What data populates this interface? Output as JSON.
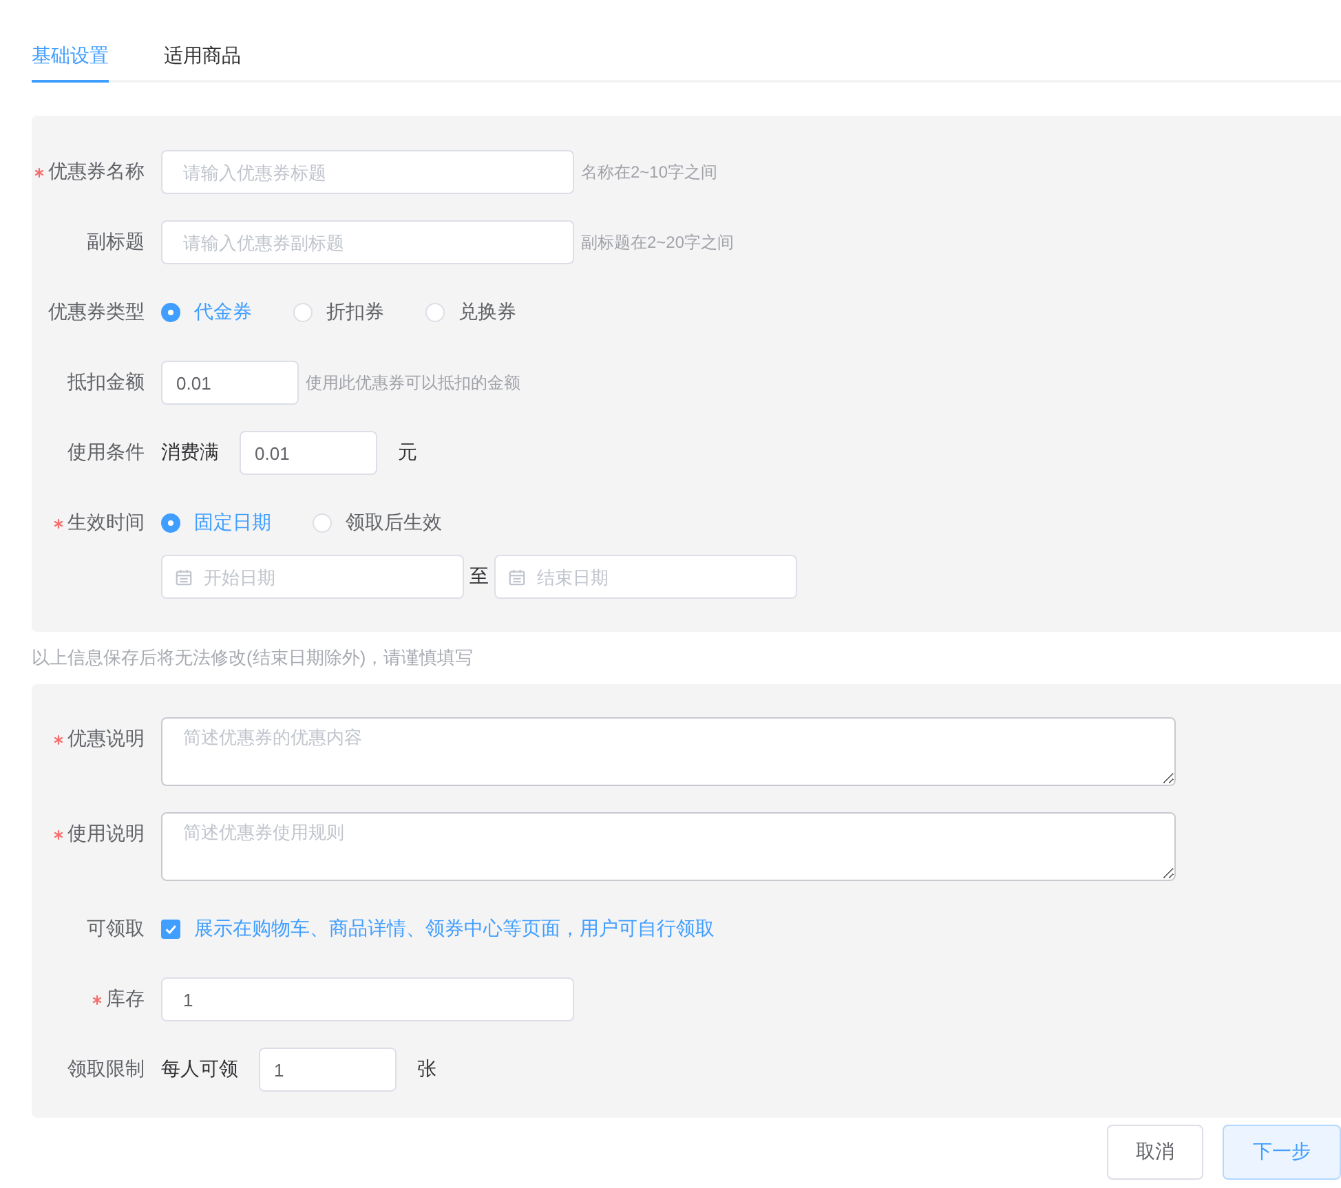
{
  "tabs": [
    {
      "label": "基础设置",
      "selected": true
    },
    {
      "label": "适用商品",
      "selected": false
    }
  ],
  "basic_section": {
    "fields": [
      {
        "kind": "text",
        "label": "优惠券名称",
        "required": true,
        "placeholder": "请输入优惠券标题",
        "hint": "名称在2~10字之间"
      },
      {
        "kind": "text",
        "label": "副标题",
        "required": false,
        "placeholder": "请输入优惠券副标题",
        "hint": "副标题在2~20字之间"
      },
      {
        "kind": "radio",
        "label": "优惠券类型",
        "required": false,
        "options": [
          {
            "label": "代金券",
            "selected": true
          },
          {
            "label": "折扣券",
            "selected": false
          },
          {
            "label": "兑换券",
            "selected": false
          }
        ]
      },
      {
        "kind": "amount",
        "label": "抵扣金额",
        "required": false,
        "value": "0.01",
        "hint": "使用此优惠券可以抵扣的金额"
      },
      {
        "kind": "condition",
        "label": "使用条件",
        "required": false,
        "prefix": "消费满",
        "value": "0.01",
        "suffix": "元"
      },
      {
        "kind": "radio",
        "label": "生效时间",
        "required": true,
        "options": [
          {
            "label": "固定日期",
            "selected": true
          },
          {
            "label": "领取后生效",
            "selected": false
          }
        ]
      },
      {
        "kind": "date_range",
        "start_placeholder": "开始日期",
        "separator": "至",
        "end_placeholder": "结束日期"
      }
    ]
  },
  "note": "以上信息保存后将无法修改(结束日期除外)，请谨慎填写",
  "detail_section": {
    "fields": [
      {
        "kind": "textarea",
        "label": "优惠说明",
        "required": true,
        "placeholder": "简述优惠券的优惠内容"
      },
      {
        "kind": "textarea",
        "label": "使用说明",
        "required": true,
        "placeholder": "简述优惠券使用规则"
      },
      {
        "kind": "checkbox",
        "label": "可领取",
        "required": false,
        "checked": true,
        "text": "展示在购物车、商品详情、领券中心等页面，用户可自行领取"
      },
      {
        "kind": "text",
        "label": "库存",
        "required": true,
        "value": "1"
      },
      {
        "kind": "condition",
        "label": "领取限制",
        "required": false,
        "prefix": "每人可领",
        "value": "1",
        "suffix": "张"
      }
    ]
  },
  "buttons": [
    {
      "label": "取消",
      "kind": "default"
    },
    {
      "label": "下一步",
      "kind": "primary"
    }
  ]
}
